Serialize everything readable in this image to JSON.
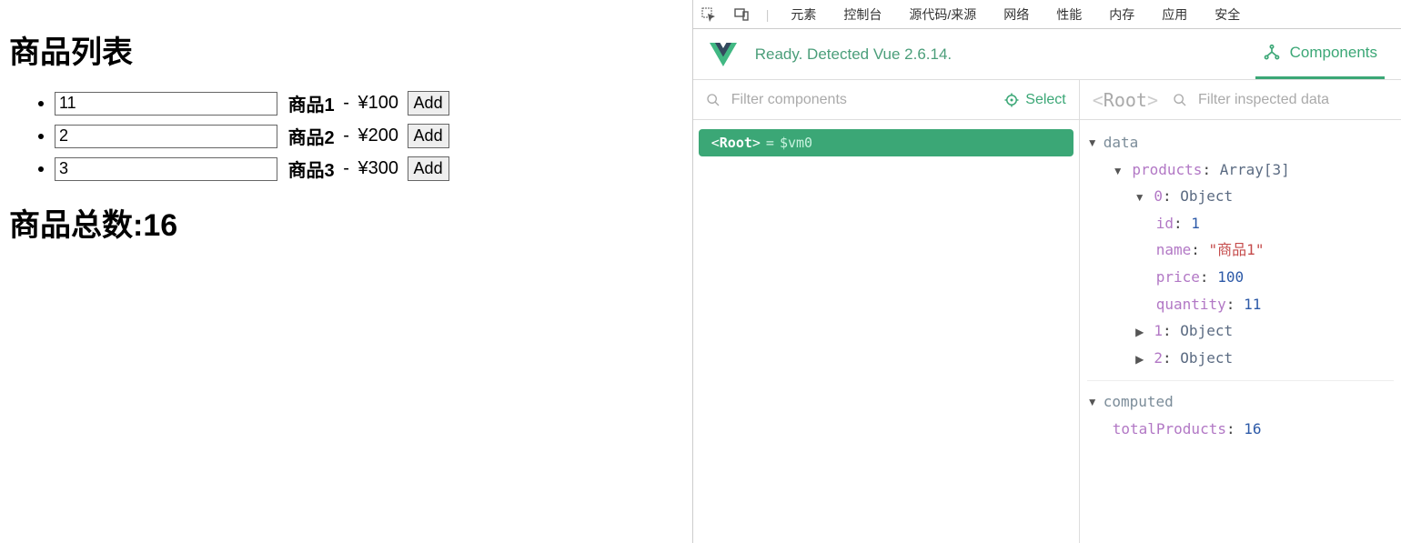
{
  "app": {
    "title": "商品列表",
    "products": [
      {
        "quantity": 11,
        "name": "商品1",
        "price": "¥100",
        "btn": "Add"
      },
      {
        "quantity": 2,
        "name": "商品2",
        "price": "¥200",
        "btn": "Add"
      },
      {
        "quantity": 3,
        "name": "商品3",
        "price": "¥300",
        "btn": "Add"
      }
    ],
    "total_label": "商品总数:",
    "total_value": "16"
  },
  "devtools": {
    "tabs": [
      "元素",
      "控制台",
      "源代码/来源",
      "网络",
      "性能",
      "内存",
      "应用",
      "安全"
    ]
  },
  "vue": {
    "status": "Ready. Detected Vue 2.6.14.",
    "components_tab": "Components",
    "filter_placeholder": "Filter components",
    "select_label": "Select",
    "root_label": "Root",
    "tree_item_label": "Root",
    "tree_item_eq": "=",
    "tree_item_vm": "$vm0",
    "inspect_placeholder": "Filter inspected data",
    "state": {
      "data_label": "data",
      "products_key": "products",
      "products_type": "Array[3]",
      "idx0": "0",
      "object_label": "Object",
      "id_key": "id",
      "id_val": "1",
      "name_key": "name",
      "name_val": "\"商品1\"",
      "price_key": "price",
      "price_val": "100",
      "quantity_key": "quantity",
      "quantity_val": "11",
      "idx1": "1",
      "idx2": "2",
      "computed_label": "computed",
      "totalProducts_key": "totalProducts",
      "totalProducts_val": "16"
    }
  }
}
